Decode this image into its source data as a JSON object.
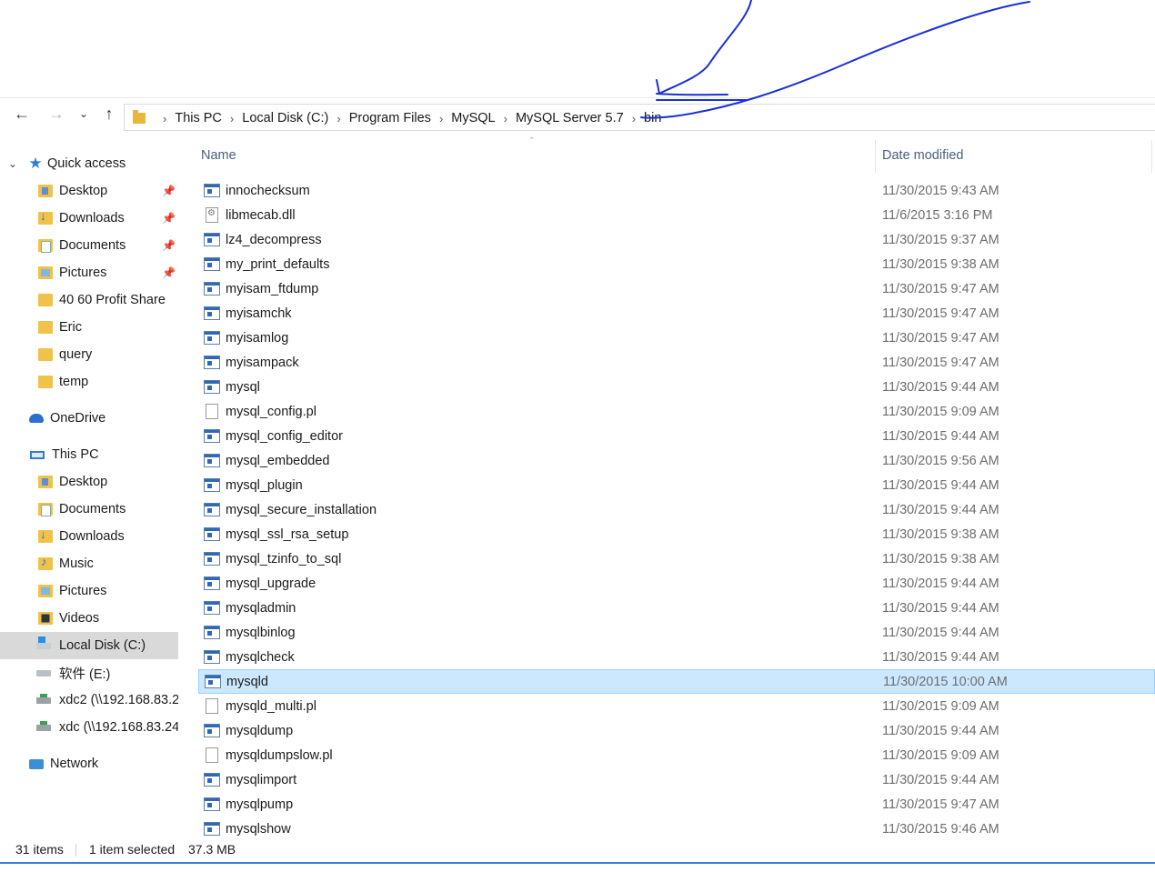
{
  "address_bar": {
    "crumbs": [
      "This PC",
      "Local Disk (C:)",
      "Program Files",
      "MySQL",
      "MySQL Server 5.7",
      "bin"
    ],
    "back_icon": "back-arrow-icon",
    "forward_icon": "forward-arrow-icon",
    "recent_icon": "chevron-down-icon",
    "up_icon": "up-arrow-icon"
  },
  "sidebar": {
    "quick_access": "Quick access",
    "qa_items": [
      "Desktop",
      "Downloads",
      "Documents",
      "Pictures",
      "40 60 Profit Share",
      "Eric",
      "query",
      "temp"
    ],
    "onedrive": "OneDrive",
    "this_pc": "This PC",
    "pc_items": [
      "Desktop",
      "Documents",
      "Downloads",
      "Music",
      "Pictures",
      "Videos",
      "Local Disk (C:)",
      "软件 (E:)",
      "xdc2 (\\\\192.168.83.2",
      "xdc (\\\\192.168.83.24"
    ],
    "network": "Network"
  },
  "columns": {
    "name": "Name",
    "date": "Date modified"
  },
  "files": [
    {
      "name": "innochecksum",
      "date": "11/30/2015 9:43 AM",
      "type": "exe"
    },
    {
      "name": "libmecab.dll",
      "date": "11/6/2015 3:16 PM",
      "type": "dll"
    },
    {
      "name": "lz4_decompress",
      "date": "11/30/2015 9:37 AM",
      "type": "exe"
    },
    {
      "name": "my_print_defaults",
      "date": "11/30/2015 9:38 AM",
      "type": "exe"
    },
    {
      "name": "myisam_ftdump",
      "date": "11/30/2015 9:47 AM",
      "type": "exe"
    },
    {
      "name": "myisamchk",
      "date": "11/30/2015 9:47 AM",
      "type": "exe"
    },
    {
      "name": "myisamlog",
      "date": "11/30/2015 9:47 AM",
      "type": "exe"
    },
    {
      "name": "myisampack",
      "date": "11/30/2015 9:47 AM",
      "type": "exe"
    },
    {
      "name": "mysql",
      "date": "11/30/2015 9:44 AM",
      "type": "exe"
    },
    {
      "name": "mysql_config.pl",
      "date": "11/30/2015 9:09 AM",
      "type": "doc"
    },
    {
      "name": "mysql_config_editor",
      "date": "11/30/2015 9:44 AM",
      "type": "exe"
    },
    {
      "name": "mysql_embedded",
      "date": "11/30/2015 9:56 AM",
      "type": "exe"
    },
    {
      "name": "mysql_plugin",
      "date": "11/30/2015 9:44 AM",
      "type": "exe"
    },
    {
      "name": "mysql_secure_installation",
      "date": "11/30/2015 9:44 AM",
      "type": "exe"
    },
    {
      "name": "mysql_ssl_rsa_setup",
      "date": "11/30/2015 9:38 AM",
      "type": "exe"
    },
    {
      "name": "mysql_tzinfo_to_sql",
      "date": "11/30/2015 9:38 AM",
      "type": "exe"
    },
    {
      "name": "mysql_upgrade",
      "date": "11/30/2015 9:44 AM",
      "type": "exe"
    },
    {
      "name": "mysqladmin",
      "date": "11/30/2015 9:44 AM",
      "type": "exe"
    },
    {
      "name": "mysqlbinlog",
      "date": "11/30/2015 9:44 AM",
      "type": "exe"
    },
    {
      "name": "mysqlcheck",
      "date": "11/30/2015 9:44 AM",
      "type": "exe"
    },
    {
      "name": "mysqld",
      "date": "11/30/2015 10:00 AM",
      "type": "exe",
      "selected": true
    },
    {
      "name": "mysqld_multi.pl",
      "date": "11/30/2015 9:09 AM",
      "type": "doc"
    },
    {
      "name": "mysqldump",
      "date": "11/30/2015 9:44 AM",
      "type": "exe"
    },
    {
      "name": "mysqldumpslow.pl",
      "date": "11/30/2015 9:09 AM",
      "type": "doc"
    },
    {
      "name": "mysqlimport",
      "date": "11/30/2015 9:44 AM",
      "type": "exe"
    },
    {
      "name": "mysqlpump",
      "date": "11/30/2015 9:47 AM",
      "type": "exe"
    },
    {
      "name": "mysqlshow",
      "date": "11/30/2015 9:46 AM",
      "type": "exe"
    }
  ],
  "status": {
    "count": "31 items",
    "selected": "1 item selected",
    "size": "37.3 MB"
  },
  "colors": {
    "selection_bg": "#cce8ff",
    "selection_border": "#99d1ff",
    "annotation": "#1a2fd6",
    "nav_selected": "#d9d9d9"
  }
}
